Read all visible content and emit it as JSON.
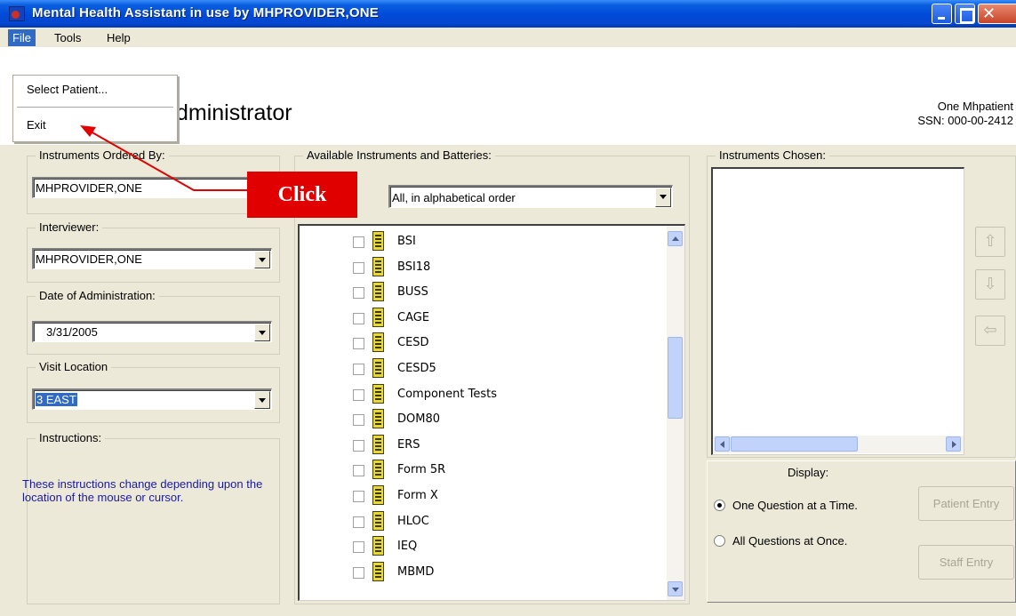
{
  "window": {
    "title": "Mental Health Assistant in use by MHPROVIDER,ONE"
  },
  "menubar": {
    "file": "File",
    "tools": "Tools",
    "help": "Help"
  },
  "file_menu": {
    "select_patient": "Select Patient...",
    "exit": "Exit"
  },
  "header": {
    "title_visible": "dministrator",
    "patient_name": "One Mhpatient",
    "patient_ssn": "SSN: 000-00-2412"
  },
  "ordered_by": {
    "label": "Instruments Ordered By:",
    "value": "MHPROVIDER,ONE"
  },
  "interviewer": {
    "label": "Interviewer:",
    "value": "MHPROVIDER,ONE"
  },
  "date_admin": {
    "label": "Date of Administration:",
    "value": "3/31/2005"
  },
  "visit_location": {
    "label": "Visit Location",
    "value": "3 EAST"
  },
  "instructions": {
    "label": "Instructions:",
    "text": "These instructions change depending upon the location of the mouse or cursor."
  },
  "available": {
    "label": "Available Instruments and Batteries:",
    "filter": "All, in alphabetical order",
    "items": [
      "BSI",
      "BSI18",
      "BUSS",
      "CAGE",
      "CESD",
      "CESD5",
      "Component Tests",
      "DOM80",
      "ERS",
      "Form 5R",
      "Form X",
      "HLOC",
      "IEQ",
      "MBMD"
    ]
  },
  "chosen": {
    "label": "Instruments Chosen:"
  },
  "side_buttons": {
    "up_icon": "arrow-up-icon",
    "down_icon": "arrow-down-icon",
    "remove_icon": "arrow-left-icon"
  },
  "display": {
    "label": "Display:",
    "one_question": "One Question at a Time.",
    "all_questions": "All Questions at Once.",
    "selected": "one_question"
  },
  "buttons": {
    "patient_entry": "Patient Entry",
    "staff_entry": "Staff Entry"
  },
  "annotation": {
    "callout": "Click",
    "color": "#E00000"
  },
  "colors": {
    "titlebar": "#0049D8",
    "menu_highlight": "#316AC5",
    "face": "#ECE9D8",
    "instructions_text": "#1A1AA0"
  }
}
